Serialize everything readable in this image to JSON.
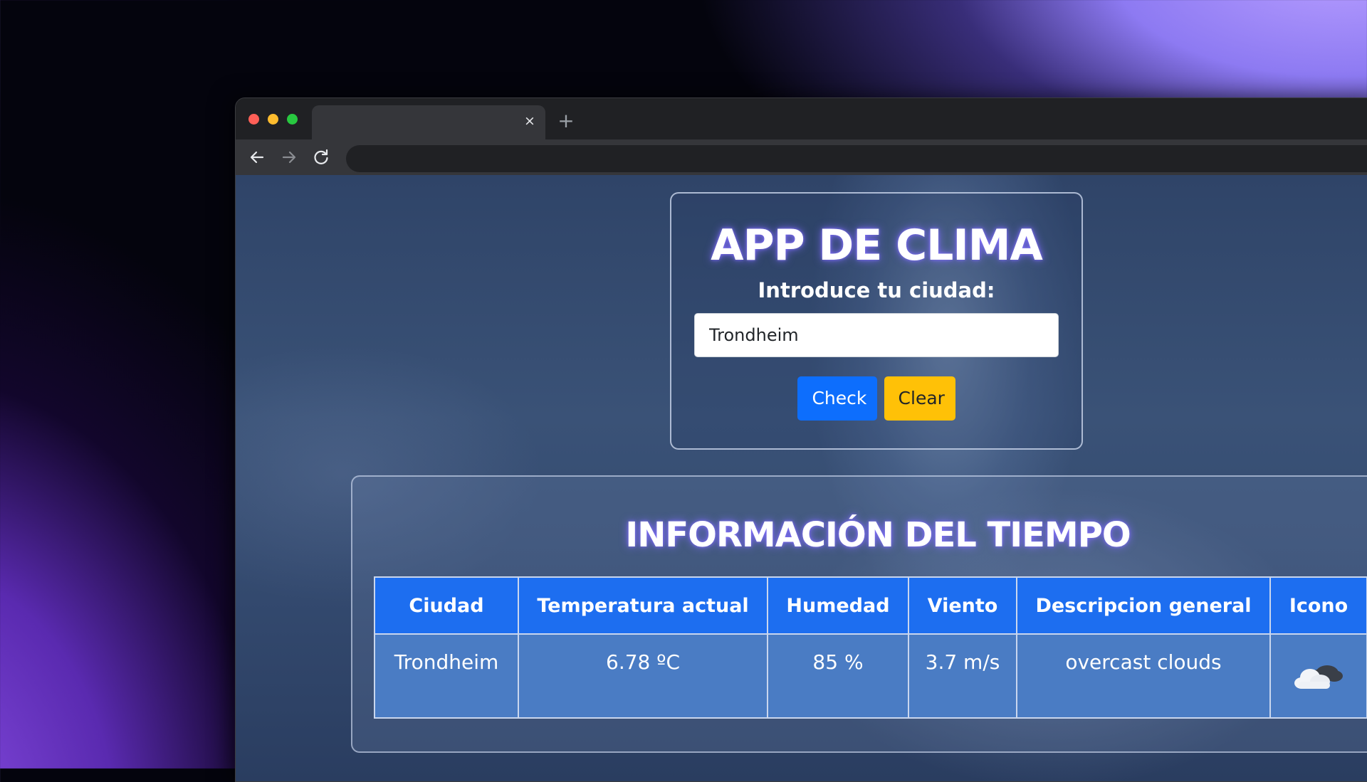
{
  "browser": {
    "tab_close": "×",
    "new_tab": "+",
    "icons": [
      "back-arrow-icon",
      "forward-arrow-icon",
      "reload-icon",
      "close-icon",
      "plus-icon"
    ]
  },
  "app": {
    "title": "APP DE CLIMA",
    "prompt": "Introduce tu ciudad:",
    "city_value": "Trondheim",
    "check_label": "Check",
    "clear_label": "Clear"
  },
  "info": {
    "title": "INFORMACIÓN DEL TIEMPO",
    "headers": [
      "Ciudad",
      "Temperatura actual",
      "Humedad",
      "Viento",
      "Descripcion general",
      "Icono"
    ],
    "row": {
      "ciudad": "Trondheim",
      "temperatura": "6.78 ºC",
      "humedad": "85 %",
      "viento": "3.7 m/s",
      "descripcion": "overcast clouds",
      "icono": "overcast-clouds-icon"
    }
  },
  "colors": {
    "check_button": "#0d6efd",
    "clear_button": "#ffc107",
    "table_header": "#1d6ef0",
    "table_row": "#4a7cc4",
    "title_glow": "#826eff"
  }
}
